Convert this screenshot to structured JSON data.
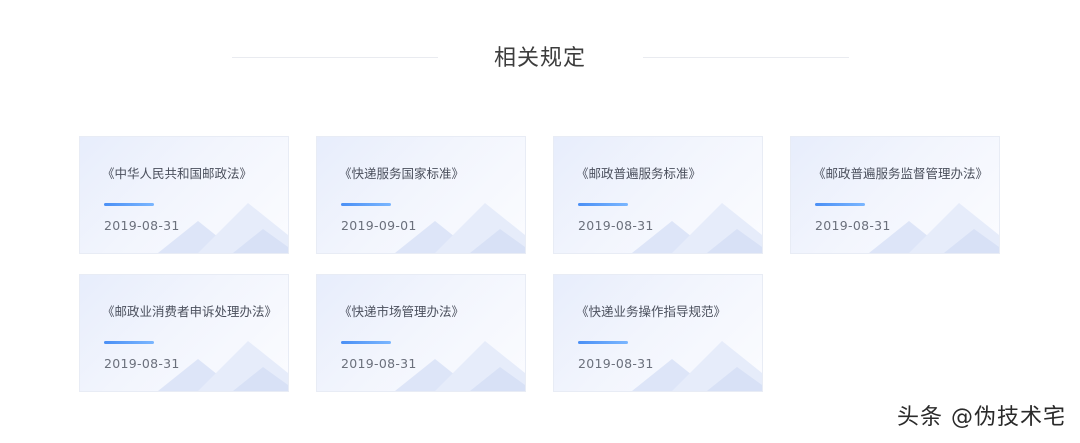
{
  "section": {
    "title": "相关规定"
  },
  "cards": [
    {
      "title": "《中华人民共和国邮政法》",
      "date": "2019-08-31"
    },
    {
      "title": "《快递服务国家标准》",
      "date": "2019-09-01"
    },
    {
      "title": "《邮政普遍服务标准》",
      "date": "2019-08-31"
    },
    {
      "title": "《邮政普遍服务监督管理办法》",
      "date": "2019-08-31"
    },
    {
      "title": "《邮政业消费者申诉处理办法》",
      "date": "2019-08-31"
    },
    {
      "title": "《快递市场管理办法》",
      "date": "2019-08-31"
    },
    {
      "title": "《快递业务操作指导规范》",
      "date": "2019-08-31"
    }
  ],
  "watermark": {
    "text": "头条 @伪技术宅"
  },
  "colors": {
    "accent": "#4a8ff5",
    "title_text": "#3d3d3d",
    "card_bg": "#eef2fd"
  }
}
